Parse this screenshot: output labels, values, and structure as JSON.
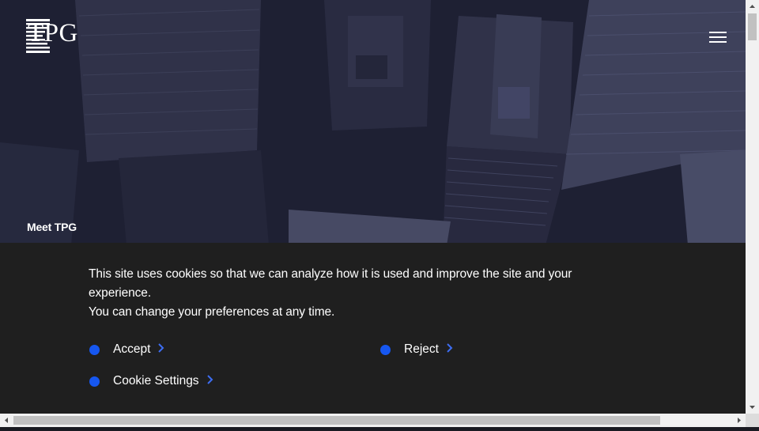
{
  "header": {
    "logo_text": "TPG",
    "logo_icon": "tpg-striped-logo-icon",
    "menu_icon": "hamburger-menu-icon"
  },
  "hero": {
    "caption": "Meet TPG"
  },
  "cookie_banner": {
    "message_line1": "This site uses cookies so that we can analyze how it is used and improve the site and your experience.",
    "message_line2": "You can change your preferences at any time.",
    "accept_label": "Accept",
    "reject_label": "Reject",
    "settings_label": "Cookie Settings",
    "accent_color": "#1657f0"
  }
}
